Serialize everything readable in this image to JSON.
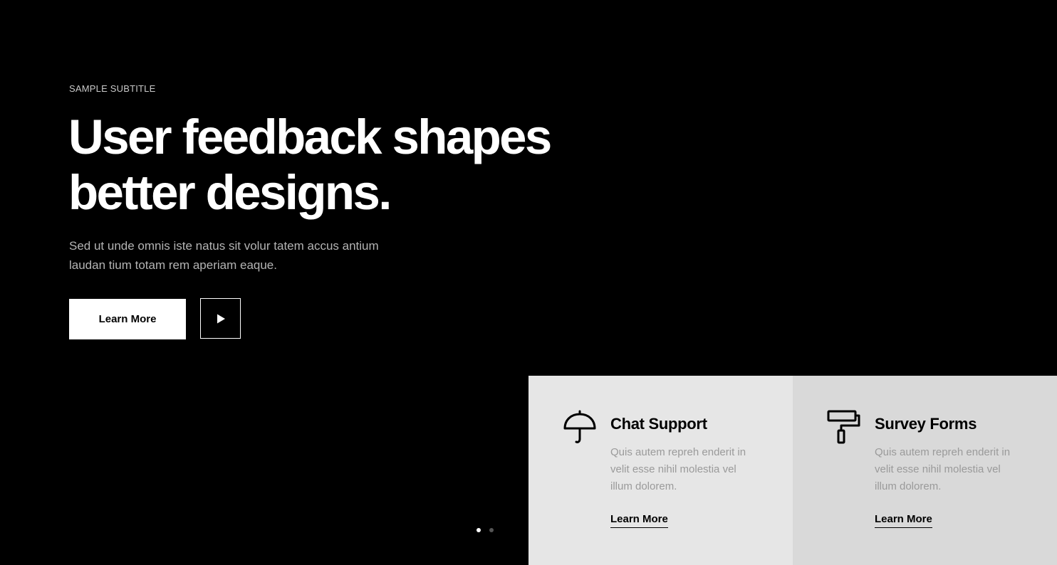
{
  "hero": {
    "subtitle": "SAMPLE SUBTITLE",
    "headline_line1": "User feedback shapes",
    "headline_line2": "better designs.",
    "description_line1": "Sed ut unde omnis iste natus sit volur tatem accus antium",
    "description_line2": "laudan tium totam rem aperiam eaque.",
    "learn_more_label": "Learn More",
    "play_icon": "play-icon"
  },
  "slider": {
    "active_index": 0,
    "count": 2
  },
  "cards": [
    {
      "icon": "umbrella-icon",
      "title": "Chat Support",
      "text_line1": "Quis autem repreh enderit in",
      "text_line2": "velit esse nihil molestia vel",
      "text_line3": "illum dolorem.",
      "link_label": "Learn More"
    },
    {
      "icon": "paint-roller-icon",
      "title": "Survey Forms",
      "text_line1": "Quis autem repreh enderit in",
      "text_line2": "velit esse nihil molestia vel",
      "text_line3": "illum dolorem.",
      "link_label": "Learn More"
    }
  ],
  "colors": {
    "background": "#000000",
    "card1_bg": "#e6e6e6",
    "card2_bg": "#d9d9d9",
    "muted_text": "#9a9a9a"
  }
}
